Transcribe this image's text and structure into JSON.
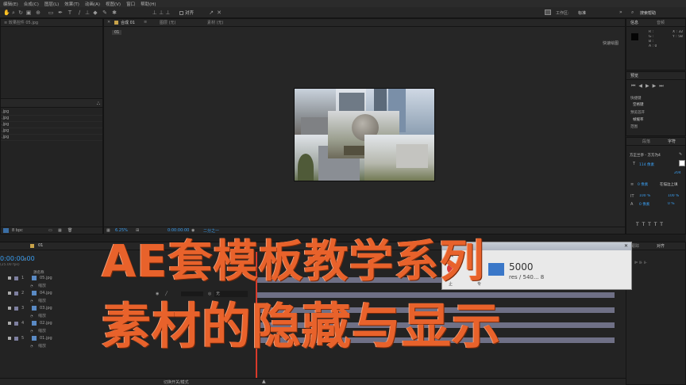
{
  "menu": [
    "编辑(E)",
    "合成(C)",
    "图层(L)",
    "效果(T)",
    "动画(A)",
    "视图(V)",
    "窗口",
    "帮助(H)"
  ],
  "toolbar": {
    "snap_label": "对齐",
    "workspace_label": "工作区:",
    "workspace_value": "标准",
    "search_label": "搜索帮助"
  },
  "project": {
    "tab": "效果控件 05.jpg",
    "files": [
      ".jpg",
      ".jpg",
      ".jpg",
      ".jpg",
      ".jpg"
    ],
    "bpc": "8 bpc"
  },
  "viewer": {
    "tab_comp": "合成 01",
    "tab_layer": "图层 (无)",
    "tab_footage": "素材 (无)",
    "comp_chip": "01",
    "fast_preview": "快速绘图",
    "zoom": "6.25%",
    "timecode": "0:00:00:00",
    "resolution": "二分之一"
  },
  "info": {
    "tab_info": "信息",
    "tab_audio": "音频",
    "r": "R :",
    "g": "G :",
    "b": "B :",
    "a": "A : 0",
    "x": "X : 32",
    "y": "Y : 58"
  },
  "preview": {
    "tab": "预览",
    "shortcut_label": "快捷键",
    "shortcut_value": "空格键",
    "include_label": "预览首开",
    "include_value": "帧缓率",
    "range_label": "范围"
  },
  "paragraph": {
    "tab_para": "段落",
    "tab_char": "字符",
    "font": "方正兰亭 - 方方为4",
    "size": "114 像素",
    "tracking": "204",
    "leading": "0 像素",
    "fill_mode": "在描边上填",
    "scale_v": "100 %",
    "scale_h": "100 %",
    "baseline": "0 像素",
    "tsume": "0 %"
  },
  "align": {
    "tab_align": "对齐",
    "tab_track": "跟踪"
  },
  "timeline": {
    "tab": "01",
    "timecode": "0:00:00:00",
    "fps": "(25.00 fps)",
    "col_name": "源名称",
    "parent_none": "无",
    "mode_toggle": "切换开关/模式",
    "layers": [
      {
        "num": "1",
        "name": "05.jpg",
        "sub": "缩放"
      },
      {
        "num": "2",
        "name": "04.jpg",
        "sub": "缩放"
      },
      {
        "num": "3",
        "name": "03.jpg",
        "sub": "缩放"
      },
      {
        "num": "4",
        "name": "02.jpg",
        "sub": "缩放"
      },
      {
        "num": "5",
        "name": "01.jpg",
        "sub": "缩放"
      }
    ]
  },
  "popup": {
    "title": "工具",
    "size_text": "5000",
    "info_text": "res / 540... 8",
    "btn1": "止",
    "btn2": "专"
  },
  "overlay": {
    "line1": "AE套模板教学系列",
    "line2": "素材的隐藏与显示"
  },
  "colors": {
    "accent": "#e8622b",
    "panel": "#232323",
    "track": "#6f7086",
    "blue": "#3a77c8"
  }
}
